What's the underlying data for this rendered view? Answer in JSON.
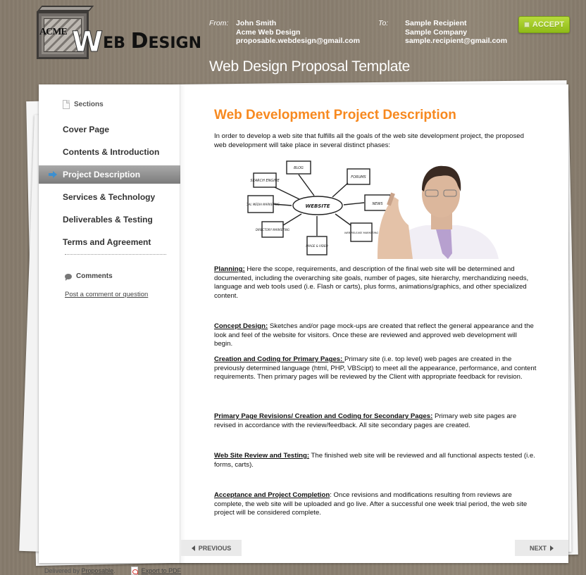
{
  "header": {
    "logo": {
      "crate_label": "ACME",
      "text_big": "W",
      "text_rest": "EB ",
      "text_cap": "D",
      "text_end": "ESIGN"
    },
    "from": {
      "label": "From:",
      "name": "John Smith",
      "company": "Acme Web Design",
      "email": "proposable.webdesign@gmail.com"
    },
    "to": {
      "label": "To:",
      "name": "Sample Recipient",
      "company": "Sample Company",
      "email": "sample.recipient@gmail.com"
    },
    "accept_label": "ACCEPT",
    "accept_color": "#a6cc2a",
    "doc_title": "Web Design Proposal Template"
  },
  "sidebar": {
    "sections_label": "Sections",
    "items": [
      {
        "label": "Cover Page",
        "active": false
      },
      {
        "label": "Contents & Introduction",
        "active": false
      },
      {
        "label": "Project Description",
        "active": true
      },
      {
        "label": "Services & Technology",
        "active": false
      },
      {
        "label": "Deliverables & Testing",
        "active": false
      },
      {
        "label": "Terms and Agreement",
        "active": false
      }
    ],
    "comments_label": "Comments",
    "comment_link": "Post a comment or question"
  },
  "main": {
    "heading": "Web Development Project Description",
    "heading_color": "#f7891f",
    "intro": "In order to develop a web site that fulfills all the goals of the web site development project, the proposed web development will take place in several distinct phases:",
    "illustration": {
      "center": "WEBSITE",
      "nodes": [
        "BLOG",
        "SEARCH ENGINE",
        "FORUMS",
        "SOCIAL MEDIA MARKETING",
        "NEWS",
        "DIRECTORY MARKETING",
        "IMAGE & VIDEO",
        "WEB RELEASE MARKETING"
      ]
    },
    "phases": [
      {
        "term": "Planning:",
        "text": " Here the scope, requirements, and description of the final web site will be determined and documented, including the overarching site goals, number of pages, site hierarchy, merchandizing needs, language and web tools used (i.e. Flash or carts), plus forms, animations/graphics, and other specialized content."
      },
      {
        "term": "Concept Design:",
        "text": " Sketches and/or page mock-ups are created that reflect the general appearance and the look and feel of the website for visitors. Once these are reviewed and approved web development will begin."
      },
      {
        "term": "Creation and Coding for Primary Pages: ",
        "text": "Primary site (i.e. top level) web pages are created in the previously determined language (html, PHP, VBScipt) to meet all the appearance, performance, and content requirements. Then primary pages will be reviewed by the Client with appropriate feedback for revision."
      },
      {
        "term": "Primary Page Revisions/ Creation and Coding for Secondary Pages:",
        "text": " Primary web site pages are revised in accordance with the review/feedback. All site secondary pages are created."
      },
      {
        "term": "Web Site Review and Testing:",
        "text": " The finished web site will be reviewed and all functional aspects tested (i.e. forms, carts)."
      },
      {
        "term": "Acceptance and Project Completion",
        "text": ": Once revisions and modifications resulting from reviews are complete, the web site will be uploaded and go live. After a successful one week trial period, the web site project will be considered complete."
      }
    ]
  },
  "pager": {
    "previous_label": "PREVIOUS",
    "next_label": "NEXT"
  },
  "footer": {
    "delivered_prefix": "Delivered by ",
    "delivered_link": "Proposable",
    "delivered_suffix": ".",
    "export_label": "Export to PDF"
  }
}
